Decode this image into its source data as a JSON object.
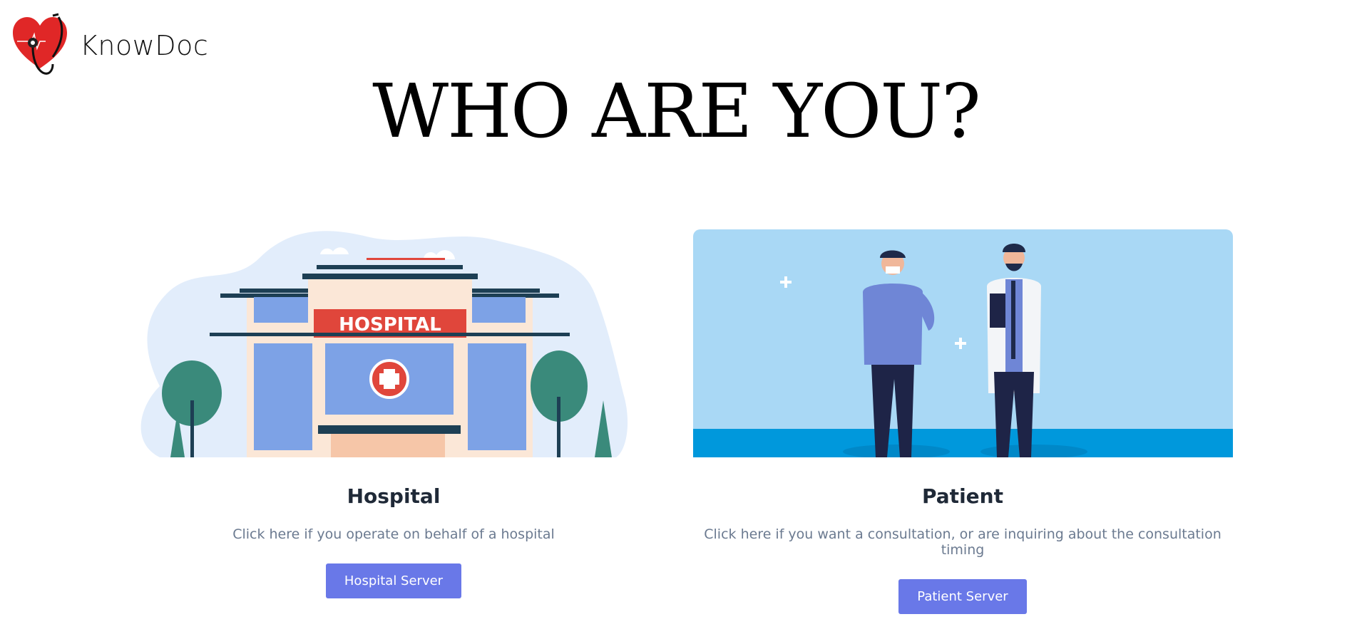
{
  "brand": {
    "name": "KnowDoc",
    "logo_icon": "heart-stethoscope-icon"
  },
  "page": {
    "title": "WHO ARE YOU?"
  },
  "cards": [
    {
      "title": "Hospital",
      "description": "Click here if you operate on behalf of a hospital",
      "button_label": "Hospital Server",
      "sign_text": "HOSPITAL"
    },
    {
      "title": "Patient",
      "description": "Click here if you want a consultation, or are inquiring about the consultation timing",
      "button_label": "Patient Server"
    }
  ],
  "colors": {
    "button": "#6978e8",
    "brand_red": "#e02727",
    "patient_sky": "#a9d8f5",
    "patient_floor": "#0098dc"
  }
}
